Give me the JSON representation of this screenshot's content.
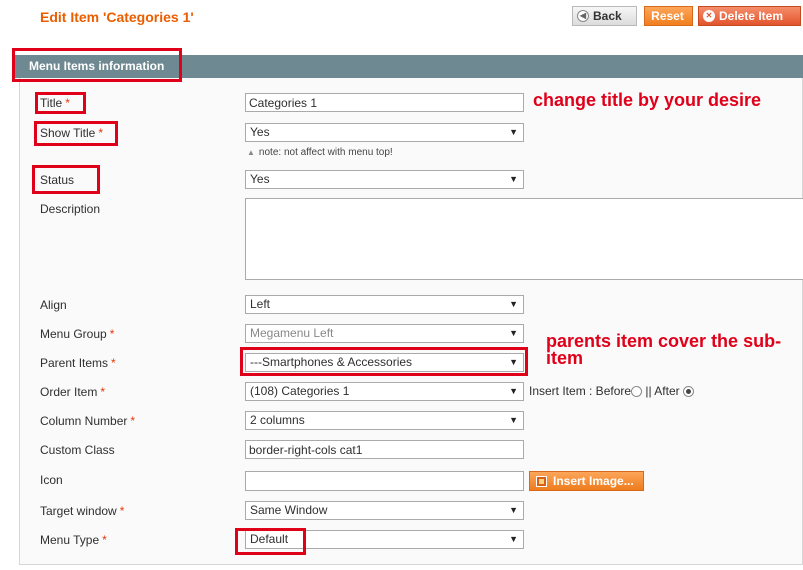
{
  "header": {
    "title": "Edit Item 'Categories 1'",
    "back_label": "Back",
    "reset_label": "Reset",
    "delete_label": "Delete Item"
  },
  "section": {
    "title": "Menu Items information"
  },
  "required_mark": "*",
  "fields": {
    "title": {
      "label": "Title",
      "value": "Categories 1"
    },
    "show_title": {
      "label": "Show Title",
      "value": "Yes",
      "note": "note: not affect with menu top!"
    },
    "status": {
      "label": "Status",
      "value": "Yes"
    },
    "description": {
      "label": "Description",
      "value": ""
    },
    "align": {
      "label": "Align",
      "value": "Left"
    },
    "menu_group": {
      "label": "Menu Group",
      "value": "Megamenu Left"
    },
    "parent_items": {
      "label": "Parent Items",
      "value": "---Smartphones & Accessories"
    },
    "order_item": {
      "label": "Order Item",
      "value": "(108) Categories 1",
      "insert_label": "Insert Item : Before",
      "after_label": "|| After",
      "selected": "After"
    },
    "column_number": {
      "label": "Column Number",
      "value": "2 columns"
    },
    "custom_class": {
      "label": "Custom Class",
      "value": "border-right-cols cat1"
    },
    "icon": {
      "label": "Icon",
      "value": "",
      "button_label": "Insert Image..."
    },
    "target_window": {
      "label": "Target window",
      "value": "Same Window"
    },
    "menu_type": {
      "label": "Menu Type",
      "value": "Default"
    }
  },
  "annotations": {
    "title_note": "change title by your desire",
    "parent_note": "parents item cover the sub-item"
  },
  "colors": {
    "accent": "#eb5e00",
    "section_bar": "#6f8992",
    "annotation": "#e0001a"
  }
}
